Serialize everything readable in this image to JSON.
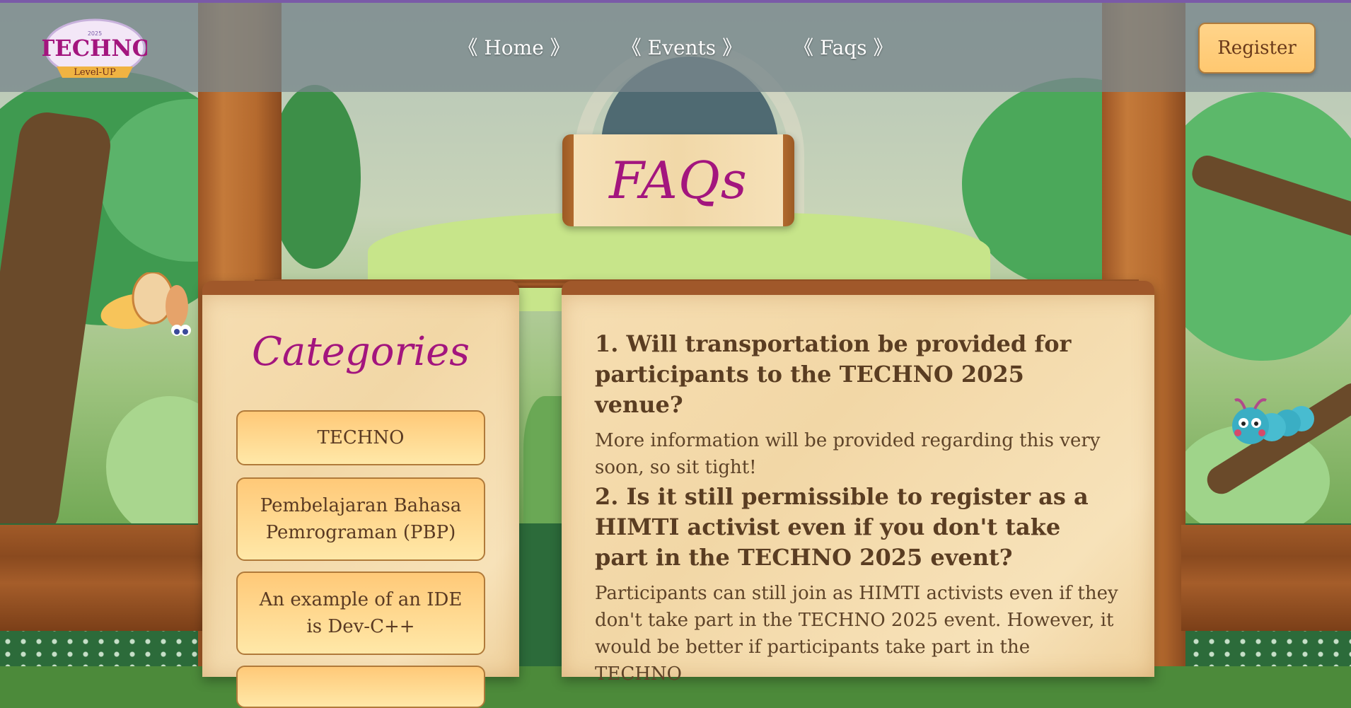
{
  "nav": {
    "logo_alt": "TECHNO 2025 Level-UP",
    "links": [
      {
        "label": "《 Home 》"
      },
      {
        "label": "《 Events 》"
      },
      {
        "label": "《 Faqs 》"
      }
    ],
    "register_label": "Register"
  },
  "page": {
    "title": "FAQs"
  },
  "categories": {
    "title": "Categories",
    "items": [
      {
        "label": "TECHNO"
      },
      {
        "label": "Pembelajaran Bahasa Pemrograman (PBP)"
      },
      {
        "label": "An example of an IDE is Dev-C++"
      },
      {
        "label": ""
      }
    ]
  },
  "faqs": [
    {
      "question": "1. Will transportation be provided for participants to the TECHNO 2025 venue?",
      "answer": "More information will be provided regarding this very soon, so sit tight!"
    },
    {
      "question": "2. Is it still permissible to register as a HIMTI activist even if you don't take part in the TECHNO 2025 event?",
      "answer": "Participants can still join as HIMTI activists even if they don't take part in the TECHNO 2025 event. However, it would be better if participants take part in the TECHNO"
    }
  ],
  "colors": {
    "accent": "#a3157e",
    "nav_top_border": "#7a5aa8",
    "wood": "#a0582a",
    "parchment": "#f6deb2",
    "button": "#ffc978"
  }
}
